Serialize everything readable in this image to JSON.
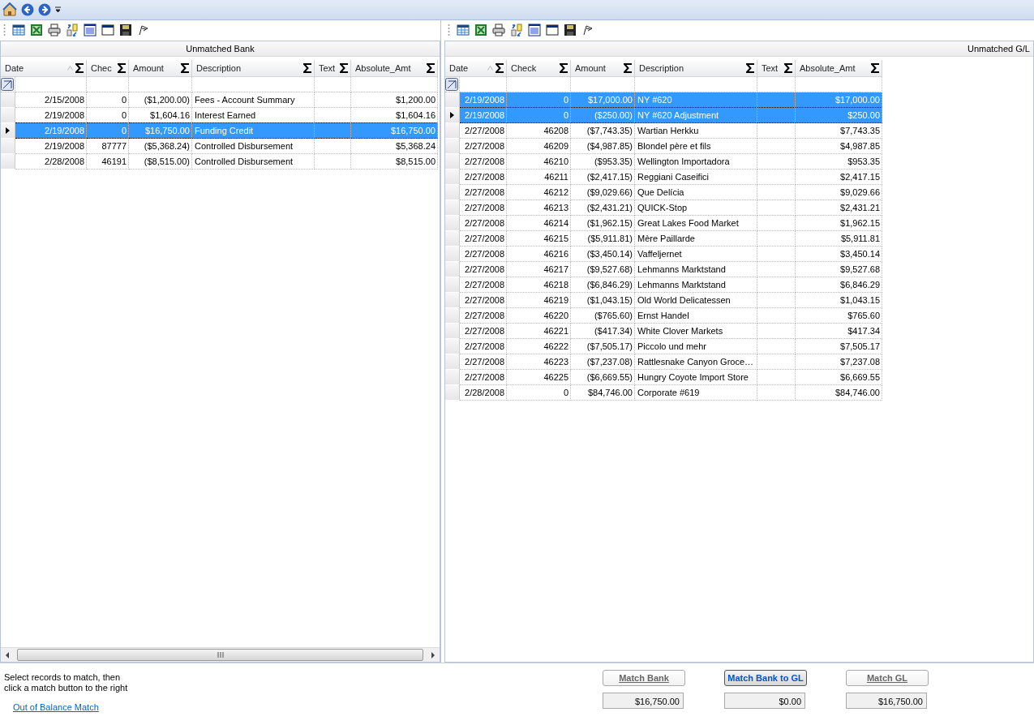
{
  "left_grid": {
    "caption": "Unmatched Bank",
    "columns": [
      {
        "label": "Date",
        "sorted": true
      },
      {
        "label": "Chec",
        "sorted": false
      },
      {
        "label": "Amount",
        "sorted": false
      },
      {
        "label": "Description",
        "sorted": false
      },
      {
        "label": "Text",
        "sorted": false
      },
      {
        "label": "Absolute_Amt",
        "sorted": false
      }
    ],
    "rows": [
      {
        "cells": [
          "2/15/2008",
          "0",
          "($1,200.00)",
          "Fees - Account Summary",
          "",
          "$1,200.00"
        ],
        "selected": false,
        "current": false
      },
      {
        "cells": [
          "2/19/2008",
          "0",
          "$1,604.16",
          "Interest Earned",
          "",
          "$1,604.16"
        ],
        "selected": false,
        "current": false
      },
      {
        "cells": [
          "2/19/2008",
          "0",
          "$16,750.00",
          "Funding Credit",
          "",
          "$16,750.00"
        ],
        "selected": true,
        "current": true
      },
      {
        "cells": [
          "2/19/2008",
          "87777",
          "($5,368.24)",
          "Controlled Disbursement",
          "",
          "$5,368.24"
        ],
        "selected": false,
        "current": false
      },
      {
        "cells": [
          "2/28/2008",
          "46191",
          "($8,515.00)",
          "Controlled Disbursement",
          "",
          "$8,515.00"
        ],
        "selected": false,
        "current": false
      }
    ]
  },
  "right_grid": {
    "caption": "Unmatched G/L",
    "columns": [
      {
        "label": "Date",
        "sorted": true
      },
      {
        "label": "Check",
        "sorted": false
      },
      {
        "label": "Amount",
        "sorted": false
      },
      {
        "label": "Description",
        "sorted": false
      },
      {
        "label": "Text",
        "sorted": false
      },
      {
        "label": "Absolute_Amt",
        "sorted": false
      }
    ],
    "rows": [
      {
        "cells": [
          "2/19/2008",
          "0",
          "$17,000.00",
          "NY #620",
          "",
          "$17,000.00"
        ],
        "selected": true,
        "current": false
      },
      {
        "cells": [
          "2/19/2008",
          "0",
          "($250.00)",
          "NY #620 Adjustment",
          "",
          "$250.00"
        ],
        "selected": true,
        "current": true
      },
      {
        "cells": [
          "2/27/2008",
          "46208",
          "($7,743.35)",
          "Wartian Herkku",
          "",
          "$7,743.35"
        ],
        "selected": false,
        "current": false
      },
      {
        "cells": [
          "2/27/2008",
          "46209",
          "($4,987.85)",
          "Blondel père et fils",
          "",
          "$4,987.85"
        ],
        "selected": false,
        "current": false
      },
      {
        "cells": [
          "2/27/2008",
          "46210",
          "($953.35)",
          "Wellington Importadora",
          "",
          "$953.35"
        ],
        "selected": false,
        "current": false
      },
      {
        "cells": [
          "2/27/2008",
          "46211",
          "($2,417.15)",
          "Reggiani Caseifici",
          "",
          "$2,417.15"
        ],
        "selected": false,
        "current": false
      },
      {
        "cells": [
          "2/27/2008",
          "46212",
          "($9,029.66)",
          "Que Delícia",
          "",
          "$9,029.66"
        ],
        "selected": false,
        "current": false
      },
      {
        "cells": [
          "2/27/2008",
          "46213",
          "($2,431.21)",
          "QUICK-Stop",
          "",
          "$2,431.21"
        ],
        "selected": false,
        "current": false
      },
      {
        "cells": [
          "2/27/2008",
          "46214",
          "($1,962.15)",
          "Great Lakes Food Market",
          "",
          "$1,962.15"
        ],
        "selected": false,
        "current": false
      },
      {
        "cells": [
          "2/27/2008",
          "46215",
          "($5,911.81)",
          "Mère Paillarde",
          "",
          "$5,911.81"
        ],
        "selected": false,
        "current": false
      },
      {
        "cells": [
          "2/27/2008",
          "46216",
          "($3,450.14)",
          "Vaffeljernet",
          "",
          "$3,450.14"
        ],
        "selected": false,
        "current": false
      },
      {
        "cells": [
          "2/27/2008",
          "46217",
          "($9,527.68)",
          "Lehmanns Marktstand",
          "",
          "$9,527.68"
        ],
        "selected": false,
        "current": false
      },
      {
        "cells": [
          "2/27/2008",
          "46218",
          "($6,846.29)",
          "Lehmanns Marktstand",
          "",
          "$6,846.29"
        ],
        "selected": false,
        "current": false
      },
      {
        "cells": [
          "2/27/2008",
          "46219",
          "($1,043.15)",
          "Old World Delicatessen",
          "",
          "$1,043.15"
        ],
        "selected": false,
        "current": false
      },
      {
        "cells": [
          "2/27/2008",
          "46220",
          "($765.60)",
          "Ernst Handel",
          "",
          "$765.60"
        ],
        "selected": false,
        "current": false
      },
      {
        "cells": [
          "2/27/2008",
          "46221",
          "($417.34)",
          "White Clover Markets",
          "",
          "$417.34"
        ],
        "selected": false,
        "current": false
      },
      {
        "cells": [
          "2/27/2008",
          "46222",
          "($7,505.17)",
          "Piccolo und mehr",
          "",
          "$7,505.17"
        ],
        "selected": false,
        "current": false
      },
      {
        "cells": [
          "2/27/2008",
          "46223",
          "($7,237.08)",
          "Rattlesnake Canyon Groce…",
          "",
          "$7,237.08"
        ],
        "selected": false,
        "current": false
      },
      {
        "cells": [
          "2/27/2008",
          "46225",
          "($6,669.55)",
          "Hungry Coyote Import Store",
          "",
          "$6,669.55"
        ],
        "selected": false,
        "current": false
      },
      {
        "cells": [
          "2/28/2008",
          "0",
          "$84,746.00",
          "Corporate #619",
          "",
          "$84,746.00"
        ],
        "selected": false,
        "current": false
      }
    ]
  },
  "instructions": "Select records to match, then\nclick a match button to the right",
  "link": "Out of Balance Match",
  "match_actions": [
    {
      "label": "Match Bank",
      "default": false,
      "total": "$16,750.00"
    },
    {
      "label": "Match Bank to GL",
      "default": true,
      "total": "$0.00"
    },
    {
      "label": "Match GL",
      "default": false,
      "total": "$16,750.00"
    }
  ]
}
